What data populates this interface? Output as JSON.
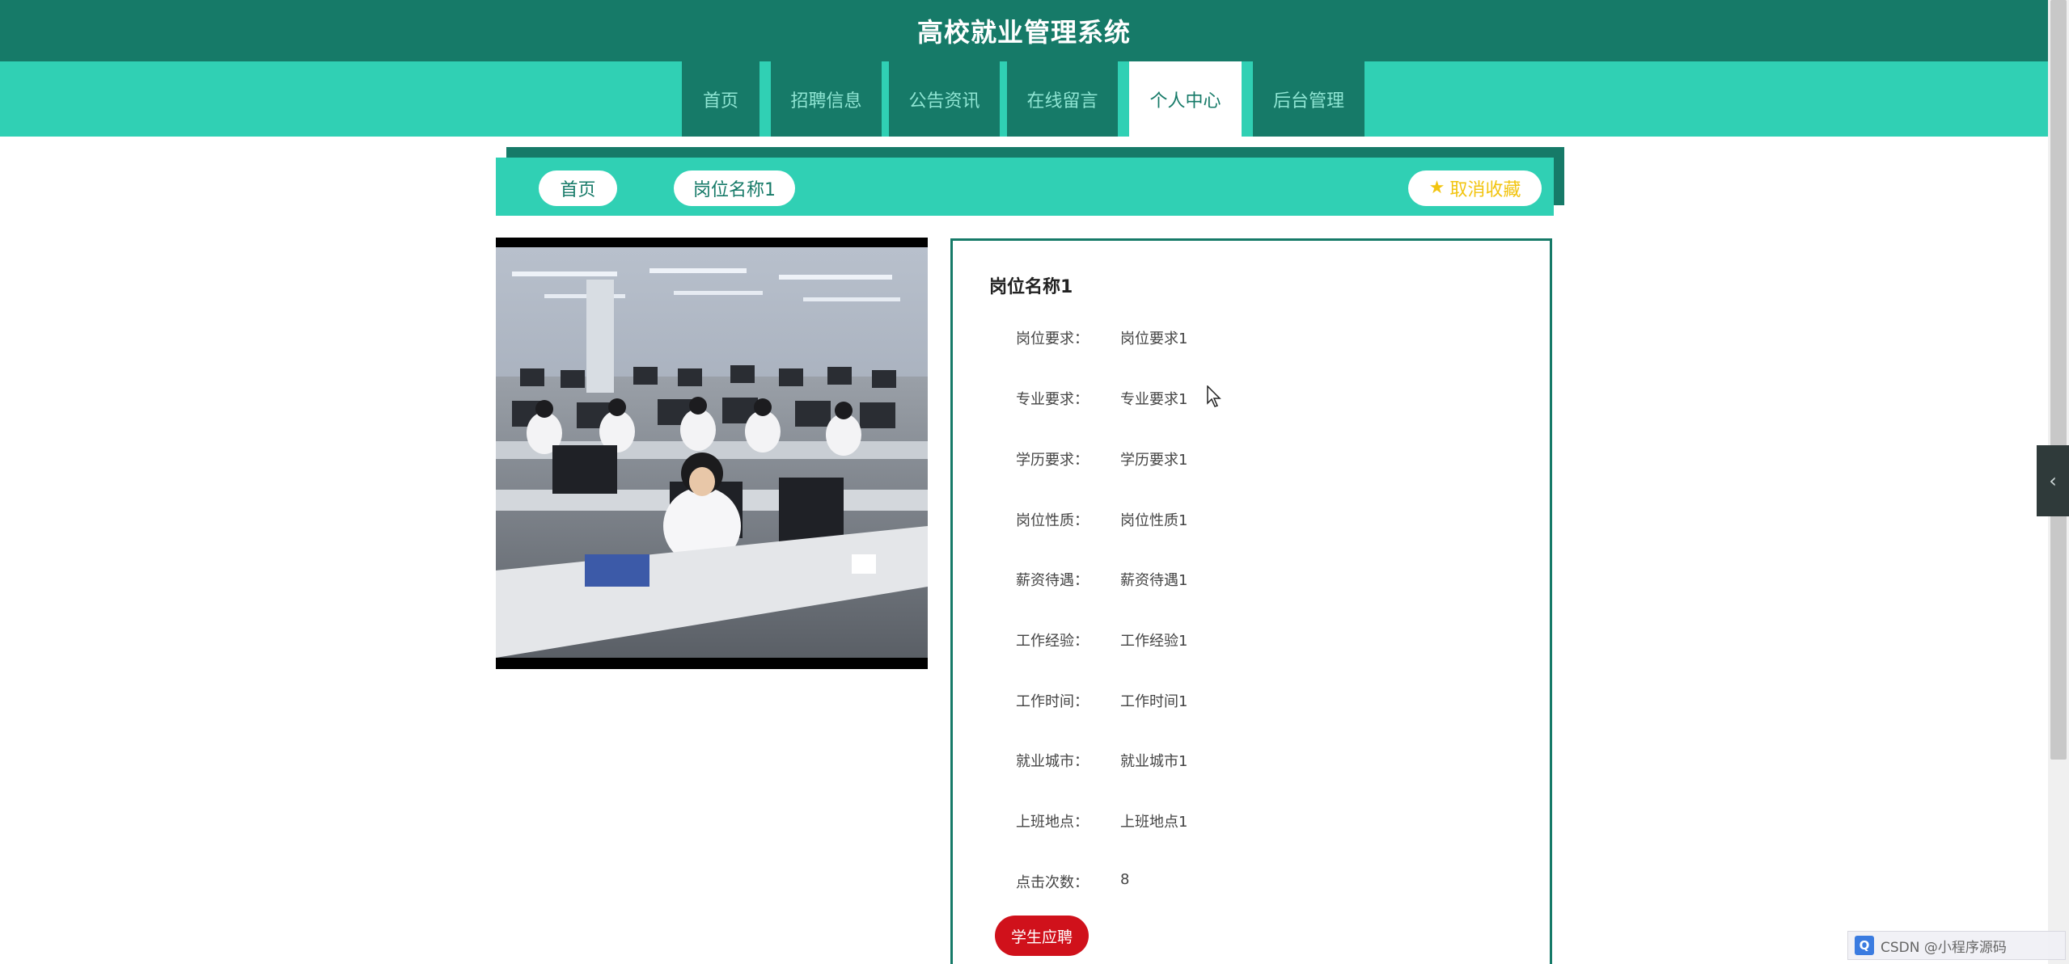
{
  "header": {
    "title": "高校就业管理系统"
  },
  "nav": {
    "items": [
      "首页",
      "招聘信息",
      "公告资讯",
      "在线留言",
      "个人中心",
      "后台管理"
    ],
    "active": "个人中心"
  },
  "breadcrumb": {
    "home": "首页",
    "current": "岗位名称1"
  },
  "favorite": {
    "label": "取消收藏",
    "icon": "star-icon"
  },
  "job": {
    "title": "岗位名称1",
    "fields": [
      {
        "label": "岗位要求：",
        "value": "岗位要求1"
      },
      {
        "label": "专业要求：",
        "value": "专业要求1"
      },
      {
        "label": "学历要求：",
        "value": "学历要求1"
      },
      {
        "label": "岗位性质：",
        "value": "岗位性质1"
      },
      {
        "label": "薪资待遇：",
        "value": "薪资待遇1"
      },
      {
        "label": "工作经验：",
        "value": "工作经验1"
      },
      {
        "label": "工作时间：",
        "value": "工作时间1"
      },
      {
        "label": "就业城市：",
        "value": "就业城市1"
      },
      {
        "label": "上班地点：",
        "value": "上班地点1"
      },
      {
        "label": "点击次数：",
        "value": "8"
      }
    ]
  },
  "apply": {
    "label": "学生应聘"
  },
  "side_toggle": {
    "icon": "chevron-left-icon"
  },
  "watermark": {
    "text": "CSDN @小程序源码"
  },
  "colors": {
    "header": "#167a68",
    "nav_bar": "#30d0b4",
    "apply_button": "#d0111b",
    "favorite_text": "#f2c40f"
  }
}
